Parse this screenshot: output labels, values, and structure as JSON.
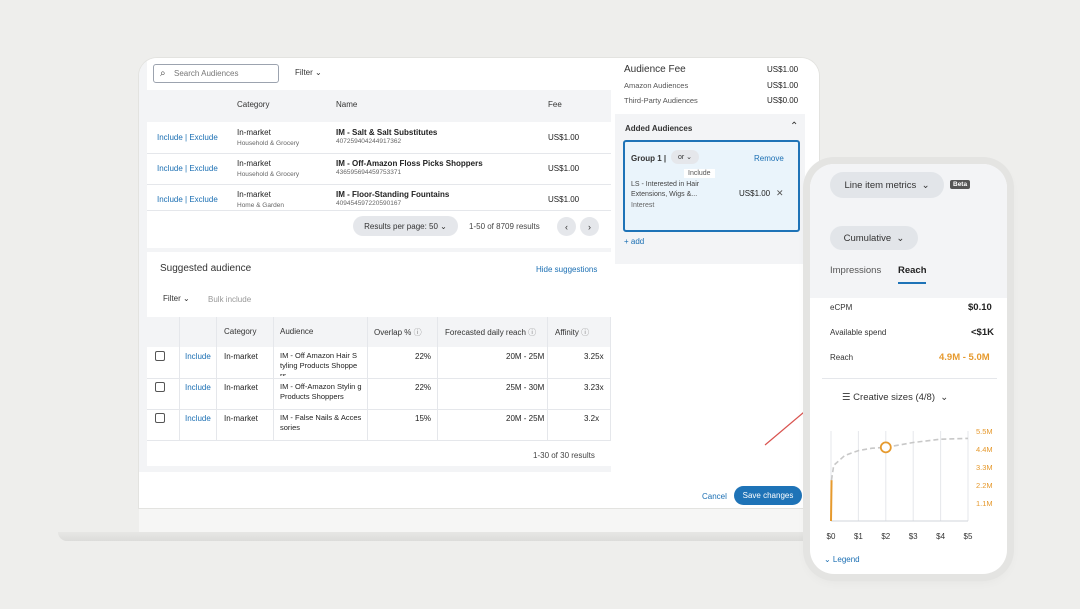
{
  "search": {
    "placeholder": "Search Audiences"
  },
  "filter_label": "Filter",
  "table1": {
    "headers": {
      "category": "Category",
      "name": "Name",
      "fee": "Fee"
    },
    "rows": [
      {
        "action": "Include | Exclude",
        "category": "In-market",
        "subcategory": "Household & Grocery",
        "name": "IM - Salt & Salt Substitutes",
        "id": "407259404244917362",
        "fee": "US$1.00"
      },
      {
        "action": "Include | Exclude",
        "category": "In-market",
        "subcategory": "Household & Grocery",
        "name": "IM - Off-Amazon Floss Picks Shoppers",
        "id": "436595694459753371",
        "fee": "US$1.00"
      },
      {
        "action": "Include | Exclude",
        "category": "In-market",
        "subcategory": "Home & Garden",
        "name": "IM - Floor-Standing Fountains",
        "id": "409454597220590167",
        "fee": "US$1.00"
      }
    ],
    "results_per_page": "Results per page: 50",
    "results_count": "1-50 of 8709 results",
    "prev": "‹",
    "next": "›"
  },
  "suggested": {
    "title": "Suggested audience",
    "hide_link": "Hide suggestions",
    "filter_label": "Filter",
    "bulk_include": "Bulk include",
    "headers": {
      "category": "Category",
      "audience": "Audience",
      "overlap": "Overlap %",
      "reach": "Forecasted daily reach",
      "affinity": "Affinity"
    },
    "rows": [
      {
        "action": "Include",
        "category": "In-market",
        "audience": "IM - Off Amazon Hair S tyling Products Shoppe rs",
        "overlap": "22%",
        "reach": "20M - 25M",
        "affinity": "3.25x"
      },
      {
        "action": "Include",
        "category": "In-market",
        "audience": "IM - Off-Amazon Stylin g Products Shoppers",
        "overlap": "22%",
        "reach": "25M - 30M",
        "affinity": "3.23x"
      },
      {
        "action": "Include",
        "category": "In-market",
        "audience": "IM - False Nails & Acces sories",
        "overlap": "15%",
        "reach": "20M - 25M",
        "affinity": "3.2x"
      }
    ],
    "results_count": "1-30 of 30 results"
  },
  "fees": {
    "audience_fee_label": "Audience Fee",
    "audience_fee": "US$1.00",
    "amazon_label": "Amazon Audiences",
    "amazon": "US$1.00",
    "third_party_label": "Third-Party Audiences",
    "third_party": "US$0.00"
  },
  "added": {
    "title": "Added Audiences",
    "group_label": "Group 1 |",
    "group_op": "or",
    "remove": "Remove",
    "include_tag": "Include",
    "item": "LS - Interested in Hair Extensions, Wigs &...",
    "item_type": "Interest",
    "item_fee": "US$1.00",
    "add": "+ add"
  },
  "footer": {
    "cancel": "Cancel",
    "save": "Save changes"
  },
  "phone": {
    "metrics_dropdown": "Line item metrics",
    "beta": "Beta",
    "cumulative": "Cumulative",
    "tabs": [
      "Impressions",
      "Reach"
    ],
    "metrics": [
      {
        "label": "eCPM",
        "value": "$0.10"
      },
      {
        "label": "Available spend",
        "value": "<$1K"
      },
      {
        "label": "Reach",
        "value": "4.9M - 5.0M"
      }
    ],
    "creative_sizes": "Creative sizes (4/8)",
    "legend": "Legend",
    "accent": "#e69a2e"
  },
  "chart_data": {
    "type": "line",
    "x_ticks": [
      "$0",
      "$1",
      "$2",
      "$3",
      "$4",
      "$5"
    ],
    "y_ticks": [
      "5.5M",
      "4.4M",
      "3.3M",
      "2.2M",
      "1.1M"
    ],
    "x": [
      0,
      0.02,
      0.1,
      0.5,
      1,
      1.5,
      2,
      3,
      4,
      5
    ],
    "y": [
      0,
      2.5,
      3.4,
      4.0,
      4.3,
      4.45,
      4.5,
      4.8,
      5.0,
      5.05
    ],
    "xlim": [
      0,
      5
    ],
    "ylim": [
      0,
      5.5
    ],
    "marker": {
      "x": 2,
      "y": 4.5
    }
  }
}
